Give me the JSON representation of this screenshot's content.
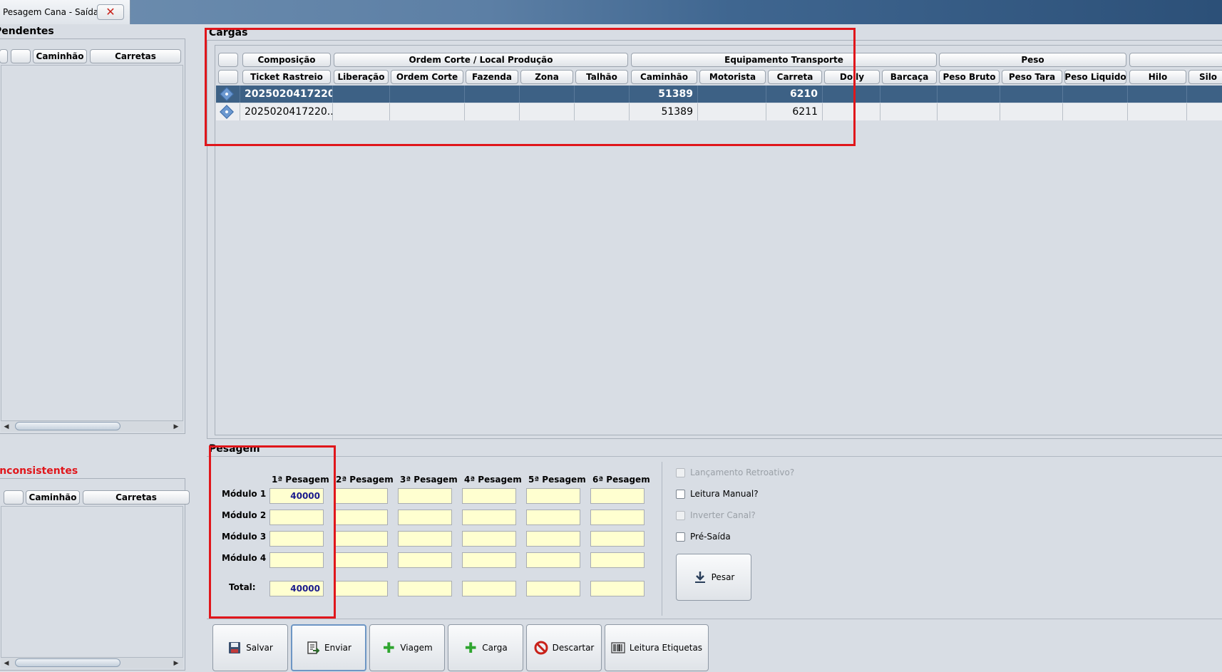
{
  "tab": {
    "title": "Pesagem Cana - Saída",
    "close_icon": "close-icon"
  },
  "pendentes": {
    "title": "Pendentes",
    "columns": [
      "",
      "",
      "Caminhão",
      "Carretas"
    ]
  },
  "inconsistentes": {
    "title": "Inconsistentes",
    "columns": [
      "",
      "Caminhão",
      "Carretas"
    ]
  },
  "cargas": {
    "title": "Cargas",
    "group_headers": [
      "",
      "Composição",
      "Ordem Corte / Local Produção",
      "Equipamento Transporte",
      "Peso",
      ""
    ],
    "columns": [
      "",
      "Ticket Rastreio",
      "Liberação",
      "Ordem Corte",
      "Fazenda",
      "Zona",
      "Talhão",
      "Caminhão",
      "Motorista",
      "Carreta",
      "Dolly",
      "Barcaça",
      "Peso Bruto",
      "Peso Tara",
      "Peso Liquido",
      "Hilo",
      "Silo"
    ],
    "rows": [
      {
        "selected": true,
        "ticket": "2025020417220...",
        "liberacao": "",
        "ordem_corte": "",
        "fazenda": "",
        "zona": "",
        "talhao": "",
        "caminhao": "51389",
        "motorista": "",
        "carreta": "6210",
        "dolly": "",
        "barcaca": "",
        "peso_bruto": "",
        "peso_tara": "",
        "peso_liquido": "",
        "hilo": "",
        "silo": ""
      },
      {
        "selected": false,
        "ticket": "2025020417220...",
        "liberacao": "",
        "ordem_corte": "",
        "fazenda": "",
        "zona": "",
        "talhao": "",
        "caminhao": "51389",
        "motorista": "",
        "carreta": "6211",
        "dolly": "",
        "barcaca": "",
        "peso_bruto": "",
        "peso_tara": "",
        "peso_liquido": "",
        "hilo": "",
        "silo": ""
      }
    ]
  },
  "pesagem": {
    "title": "Pesagem",
    "columns": [
      "1ª Pesagem",
      "2ª Pesagem",
      "3ª Pesagem",
      "4ª Pesagem",
      "5ª Pesagem",
      "6ª Pesagem"
    ],
    "modules": [
      {
        "label": "Módulo 1",
        "values": [
          "40000",
          "",
          "",
          "",
          "",
          ""
        ]
      },
      {
        "label": "Módulo 2",
        "values": [
          "",
          "",
          "",
          "",
          "",
          ""
        ]
      },
      {
        "label": "Módulo 3",
        "values": [
          "",
          "",
          "",
          "",
          "",
          ""
        ]
      },
      {
        "label": "Módulo 4",
        "values": [
          "",
          "",
          "",
          "",
          "",
          ""
        ]
      }
    ],
    "total": {
      "label": "Total:",
      "values": [
        "40000",
        "",
        "",
        "",
        "",
        ""
      ]
    }
  },
  "options": {
    "lancamento_retroativo": "Lançamento Retroativo?",
    "leitura_manual": "Leitura Manual?",
    "inverter_canal": "Inverter Canal?",
    "pre_saida": "Pré-Saída",
    "pesar": "Pesar"
  },
  "actions": {
    "salvar": "Salvar",
    "enviar": "Enviar",
    "viagem": "Viagem",
    "carga": "Carga",
    "descartar": "Descartar",
    "leitura_etiquetas": "Leitura Etiquetas"
  },
  "colors": {
    "selection": "#3d6185",
    "highlight_box": "#e0161b",
    "input_bg": "#ffffd0",
    "error_title": "#e0161b"
  }
}
